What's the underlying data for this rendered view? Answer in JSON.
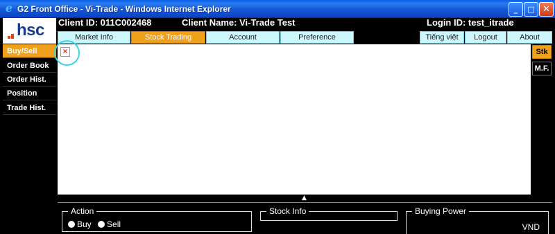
{
  "window": {
    "title": "G2 Front Office - Vi-Trade - Windows Internet Explorer",
    "minimize": "_",
    "maximize": "□",
    "close": "✕"
  },
  "header": {
    "client_id": "Client ID: 011C002468",
    "client_name": "Client Name: Vi-Trade Test",
    "login_id": "Login ID: test_itrade"
  },
  "logo": {
    "text": "hsc"
  },
  "tabs": [
    {
      "label": "Market Info",
      "active": false
    },
    {
      "label": "Stock Trading",
      "active": true
    },
    {
      "label": "Account",
      "active": false
    },
    {
      "label": "Preference",
      "active": false
    },
    {
      "label": "Tiếng việt",
      "active": false
    },
    {
      "label": "Logout",
      "active": false
    },
    {
      "label": "About",
      "active": false
    }
  ],
  "sidebar": {
    "items": [
      {
        "label": "Buy/Sell",
        "active": true
      },
      {
        "label": "Order Book",
        "active": false
      },
      {
        "label": "Order Hist.",
        "active": false
      },
      {
        "label": "Position",
        "active": false
      },
      {
        "label": "Trade Hist.",
        "active": false
      }
    ]
  },
  "right_buttons": {
    "stk": "Stk",
    "mf": "M.F."
  },
  "splitter": {
    "arrow": "▲"
  },
  "panels": {
    "action": {
      "title": "Action",
      "buy": "Buy",
      "sell": "Sell"
    },
    "stock_info": {
      "title": "Stock Info"
    },
    "buying_power": {
      "title": "Buying Power",
      "currency": "VND"
    }
  },
  "colors": {
    "accent": "#f0a11c",
    "tab_bg": "#ccf7fc",
    "titlebar": "#1457d6",
    "highlight": "#33d6e8"
  },
  "icons": {
    "browser": "ie-icon",
    "broken_image": "broken-image-icon"
  }
}
